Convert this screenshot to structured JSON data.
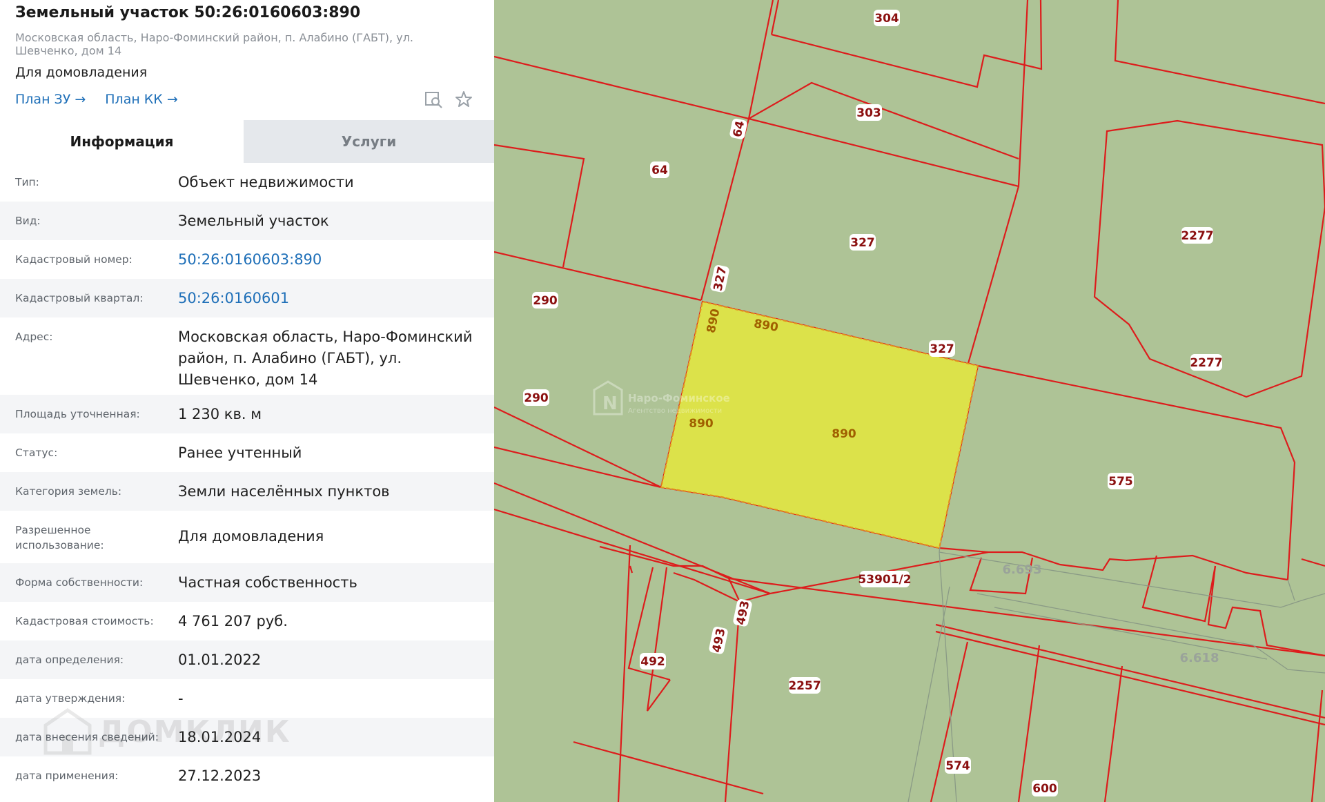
{
  "header": {
    "title": "Земельный участок 50:26:0160603:890",
    "address": "Московская область, Наро-Фоминский район, п. Алабино (ГАБТ), ул. Шевченко, дом 14",
    "usage": "Для домовладения",
    "links": [
      {
        "label": "План ЗУ →"
      },
      {
        "label": "План КК →"
      }
    ],
    "icons": [
      "search-map-icon",
      "star-icon"
    ]
  },
  "tabs": [
    {
      "label": "Информация",
      "active": true
    },
    {
      "label": "Услуги",
      "active": false
    }
  ],
  "info_rows": [
    {
      "label": "Тип:",
      "value": "Объект недвижимости",
      "link": false
    },
    {
      "label": "Вид:",
      "value": "Земельный участок",
      "link": false
    },
    {
      "label": "Кадастровый номер:",
      "value": "50:26:0160603:890",
      "link": true
    },
    {
      "label": "Кадастровый квартал:",
      "value": "50:26:0160601",
      "link": true
    },
    {
      "label": "Адрес:",
      "value": "Московская область, Наро-Фоминский район, п. Алабино (ГАБТ), ул. Шевченко, дом 14",
      "link": false
    },
    {
      "label": "Площадь уточненная:",
      "value": "1 230 кв. м",
      "link": false
    },
    {
      "label": "Статус:",
      "value": "Ранее учтенный",
      "link": false
    },
    {
      "label": "Категория земель:",
      "value": "Земли населённых пунктов",
      "link": false
    },
    {
      "label": "Разрешенное использование:",
      "value": "Для домовладения",
      "link": false
    },
    {
      "label": "Форма собственности:",
      "value": "Частная собственность",
      "link": false
    },
    {
      "label": "Кадастровая стоимость:",
      "value": "4 761 207 руб.",
      "link": false
    },
    {
      "label": "дата определения:",
      "value": "01.01.2022",
      "link": false
    },
    {
      "label": "дата утверждения:",
      "value": "-",
      "link": false
    },
    {
      "label": "дата внесения сведений:",
      "value": "18.01.2024",
      "link": false
    },
    {
      "label": "дата применения:",
      "value": "27.12.2023",
      "link": false
    }
  ],
  "map": {
    "parcel_labels": [
      "304",
      "303",
      "64",
      "64",
      "327",
      "327",
      "327",
      "2277",
      "2277",
      "290",
      "290",
      "890",
      "890",
      "890",
      "890",
      "575",
      "53901/2",
      "6.693",
      "493",
      "493",
      "492",
      "2257",
      "6.618",
      "574",
      "600"
    ],
    "watermark": {
      "line1": "Наро-Фоминское",
      "line2": "Агентство недвижимости"
    },
    "panel_watermark": "ДОМКЛИК",
    "colors": {
      "map_bg": "#aec396",
      "parcel_border": "#e01f1f",
      "selected_fill": "#dce24a",
      "label_text": "#8b1010"
    }
  }
}
